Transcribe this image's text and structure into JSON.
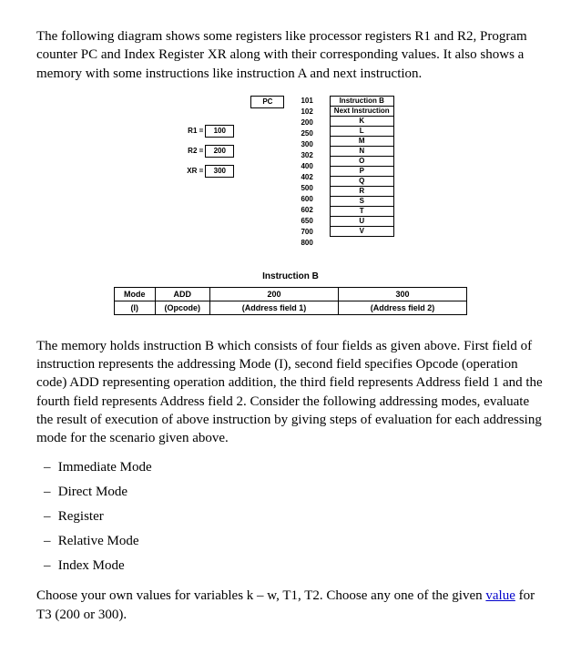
{
  "intro": "The following diagram shows some registers like processor registers R1 and R2, Program counter PC and Index Register XR along with their corresponding values. It also shows a memory with some instructions like instruction A and next instruction.",
  "pc_label": "PC",
  "registers": [
    {
      "label": "R1 =",
      "value": "100"
    },
    {
      "label": "R2 =",
      "value": "200"
    },
    {
      "label": "XR =",
      "value": "300"
    }
  ],
  "addresses": [
    "101",
    "102",
    "200",
    "250",
    "300",
    "302",
    "400",
    "402",
    "500",
    "600",
    "602",
    "650",
    "700",
    "800"
  ],
  "memory": [
    "Instruction B",
    "Next Instruction",
    "K",
    "L",
    "M",
    "N",
    "O",
    "P",
    "Q",
    "R",
    "S",
    "T",
    "U",
    "V"
  ],
  "instrB_title": "Instruction B",
  "instrB_row1": [
    "Mode",
    "ADD",
    "200",
    "300"
  ],
  "instrB_row2": [
    "(I)",
    "(Opcode)",
    "(Address field 1)",
    "(Address field 2)"
  ],
  "para2": "The memory holds instruction B which consists of four fields as given above. First field of instruction represents the addressing Mode (I), second field specifies Opcode (operation code) ADD representing operation addition, the third field represents Address field 1 and the fourth field represents Address field 2. Consider the following addressing modes, evaluate the result of execution of above instruction by giving steps of evaluation for each addressing mode for the scenario given above.",
  "modes": [
    "Immediate Mode",
    "Direct Mode",
    "Register",
    "Relative Mode",
    "Index Mode"
  ],
  "closing_pre": "Choose your own values for variables k – w, T1, T2. Choose any one of the given ",
  "closing_link": "value",
  "closing_post": " for T3 (200 or 300)."
}
